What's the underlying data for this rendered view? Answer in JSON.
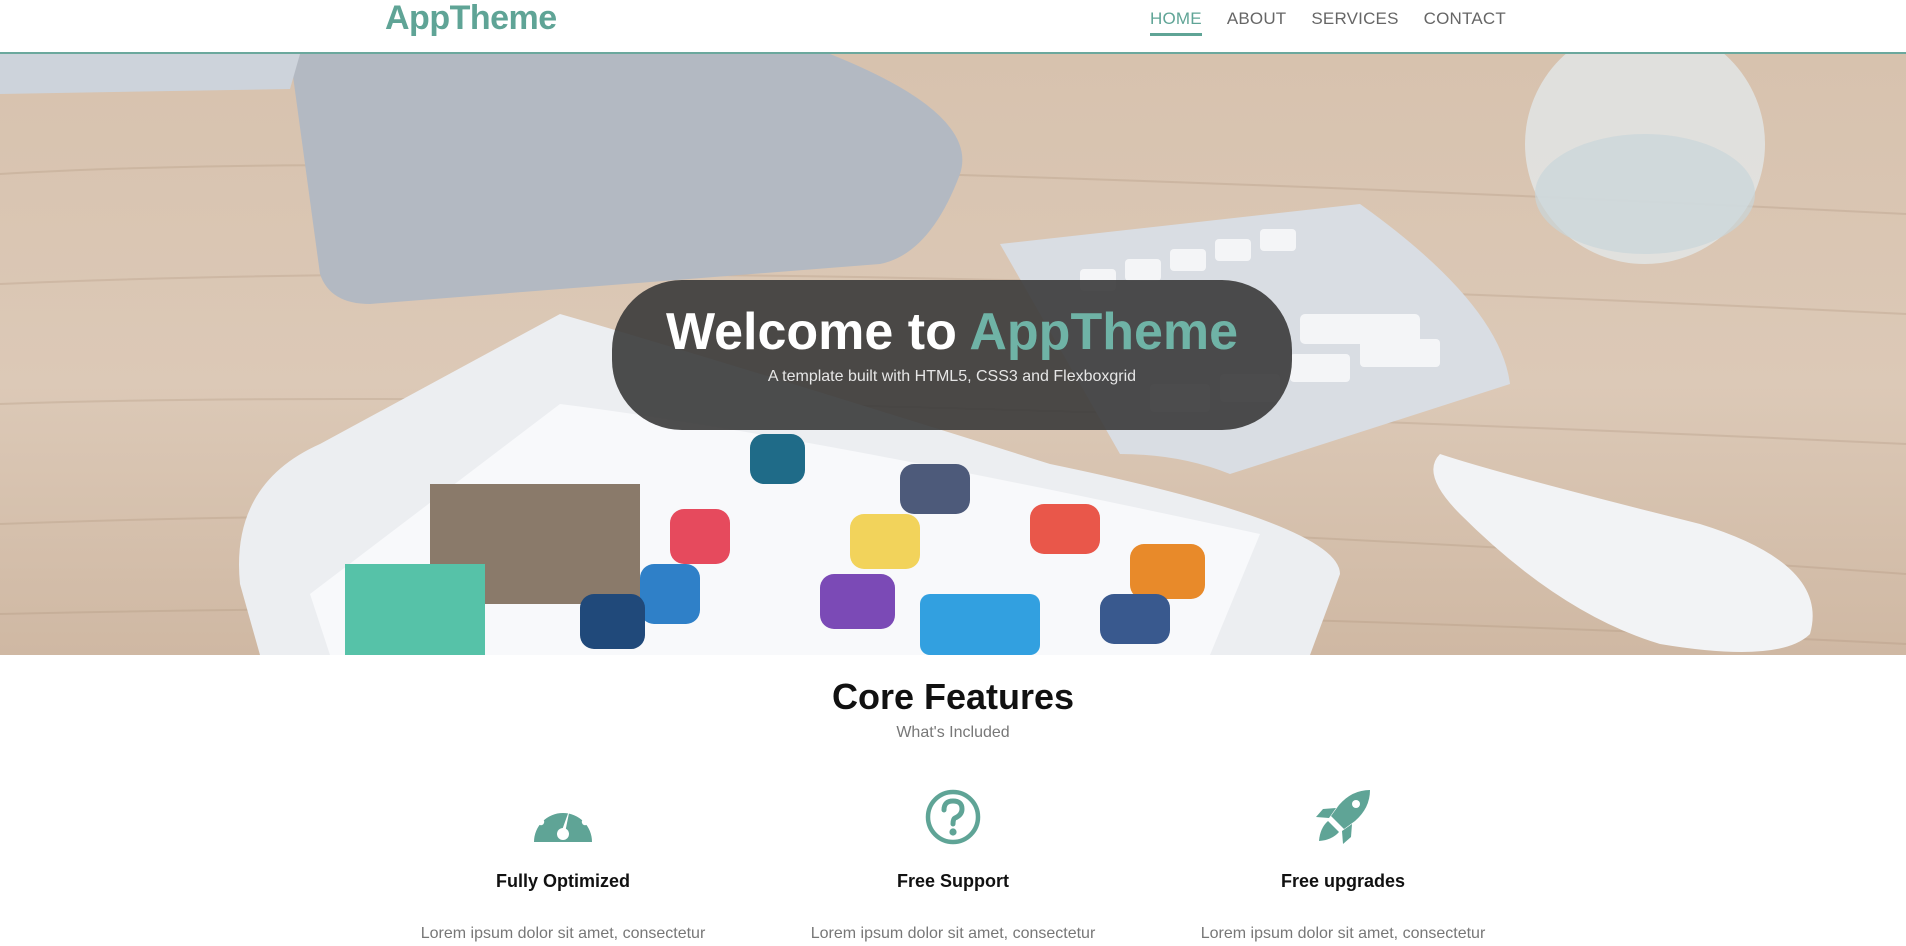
{
  "header": {
    "logo": "AppTheme",
    "nav": [
      {
        "label": "HOME",
        "active": true
      },
      {
        "label": "ABOUT",
        "active": false
      },
      {
        "label": "SERVICES",
        "active": false
      },
      {
        "label": "CONTACT",
        "active": false
      }
    ]
  },
  "hero": {
    "title_prefix": "Welcome to ",
    "title_accent": "AppTheme",
    "subtitle": "A template built with HTML5, CSS3 and Flexboxgrid"
  },
  "features": {
    "title": "Core Features",
    "subtitle": "What's Included",
    "items": [
      {
        "icon": "dashboard-icon",
        "title": "Fully Optimized",
        "text": "Lorem ipsum dolor sit amet, consectetur"
      },
      {
        "icon": "question-circle-icon",
        "title": "Free Support",
        "text": "Lorem ipsum dolor sit amet, consectetur"
      },
      {
        "icon": "rocket-icon",
        "title": "Free upgrades",
        "text": "Lorem ipsum dolor sit amet, consectetur"
      }
    ]
  },
  "colors": {
    "accent": "#5fa496",
    "hero_card": "#3a3a3a"
  }
}
